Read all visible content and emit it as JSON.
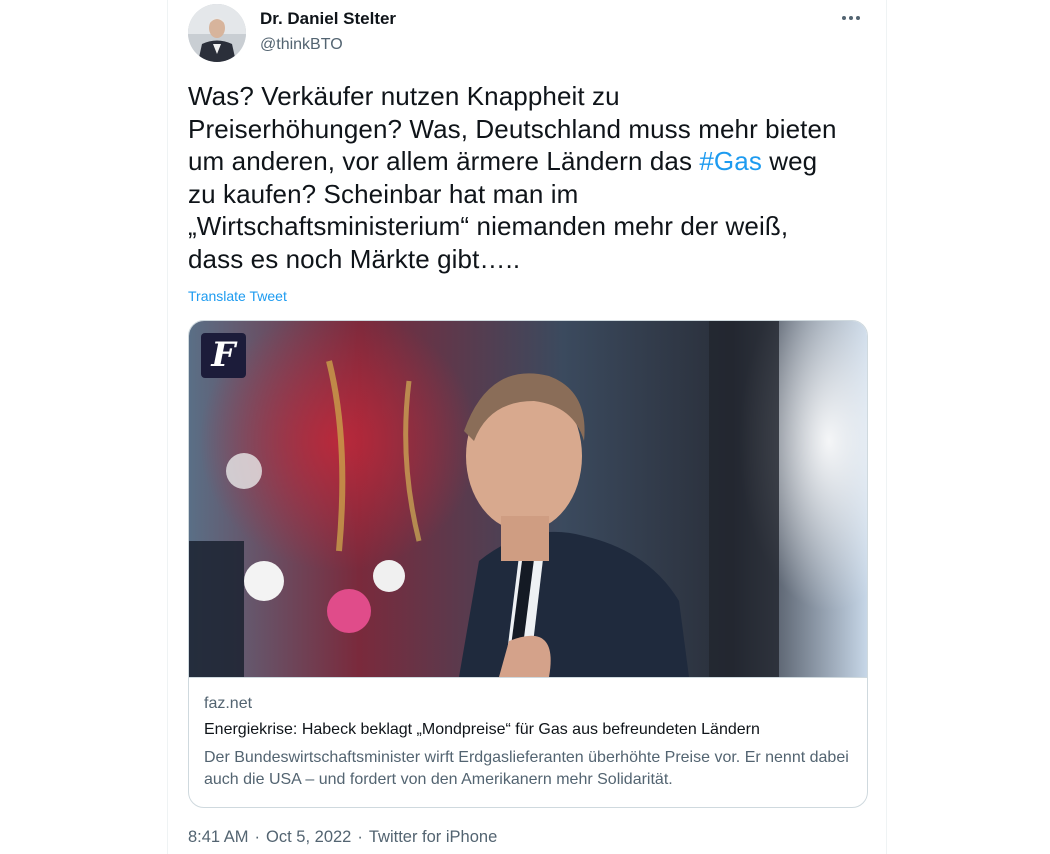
{
  "author": {
    "name": "Dr. Daniel Stelter",
    "handle": "@thinkBTO"
  },
  "tweet": {
    "text_before_hashtag": "Was? Verkäufer nutzen Knappheit zu\nPreiserhöhungen? Was, Deutschland muss mehr bieten\num anderen, vor allem ärmere Ländern das ",
    "hashtag": "#Gas",
    "text_after_hashtag": " weg\nzu kaufen? Scheinbar hat man im\n„Wirtschaftsministerium“ niemanden mehr der weiß,\ndass es noch Märkte gibt…..",
    "translate_label": "Translate Tweet"
  },
  "card": {
    "logo_letter": "F",
    "domain": "faz.net",
    "title": "Energiekrise: Habeck beklagt „Mondpreise“ für Gas aus befreundeten Ländern",
    "description": "Der Bundeswirtschaftsminister wirft Erdgaslieferanten überhöhte Preise vor. Er nennt dabei auch die USA – und fordert von den Amerikanern mehr Solidarität."
  },
  "meta": {
    "time": "8:41 AM",
    "date": "Oct 5, 2022",
    "source": "Twitter for iPhone",
    "separator": "·"
  },
  "colors": {
    "accent": "#1d9bf0",
    "secondary_text": "#536471",
    "border": "#cfd9de"
  },
  "icons": {
    "more": "more-horizontal-icon"
  }
}
